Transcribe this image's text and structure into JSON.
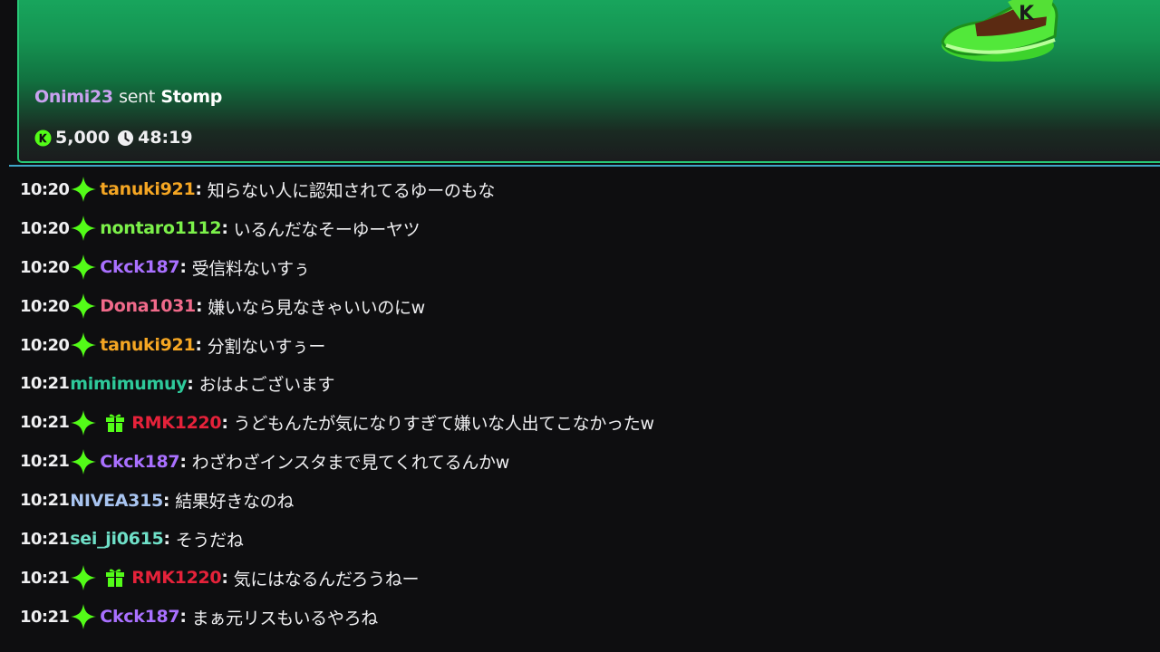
{
  "gift": {
    "user": "Onimi23",
    "verb": "sent",
    "item": "Stomp",
    "amount": "5,000",
    "time": "48:19",
    "icons": [
      "shoe-gift-art",
      "kick-coin-icon",
      "clock-icon"
    ]
  },
  "colors": {
    "accent_green": "#53fc18",
    "card_border": "#27c877",
    "divider": "#3fa6c9",
    "background": "#0e0e10"
  },
  "messages": [
    {
      "time": "10:20",
      "badge": "sparkle",
      "gift_badge": false,
      "user": "tanuki921",
      "color": "#f5a623",
      "text": "知らない人に認知されてるゆーのもな"
    },
    {
      "time": "10:20",
      "badge": "sparkle",
      "gift_badge": false,
      "user": "nontaro1112",
      "color": "#7cf14a",
      "text": "いるんだなそーゆーヤツ"
    },
    {
      "time": "10:20",
      "badge": "sparkle",
      "gift_badge": false,
      "user": "Ckck187",
      "color": "#a970ff",
      "text": "受信料ないすぅ"
    },
    {
      "time": "10:20",
      "badge": "sparkle",
      "gift_badge": false,
      "user": "Dona1031",
      "color": "#f06a8a",
      "text": "嫌いなら見なきゃいいのにw"
    },
    {
      "time": "10:20",
      "badge": "sparkle",
      "gift_badge": false,
      "user": "tanuki921",
      "color": "#f5a623",
      "text": "分割ないすぅー"
    },
    {
      "time": "10:21",
      "badge": "",
      "gift_badge": false,
      "user": "mimimumuy",
      "color": "#2ec99a",
      "text": "おはよございます"
    },
    {
      "time": "10:21",
      "badge": "sparkle",
      "gift_badge": true,
      "user": "RMK1220",
      "color": "#e5223a",
      "text": "うどもんたが気になりすぎて嫌いな人出てこなかったw"
    },
    {
      "time": "10:21",
      "badge": "sparkle",
      "gift_badge": false,
      "user": "Ckck187",
      "color": "#a970ff",
      "text": "わざわざインスタまで見てくれてるんかw"
    },
    {
      "time": "10:21",
      "badge": "",
      "gift_badge": false,
      "user": "NIVEA315",
      "color": "#a8c4f0",
      "text": "結果好きなのね"
    },
    {
      "time": "10:21",
      "badge": "",
      "gift_badge": false,
      "user": "sei_ji0615",
      "color": "#6fe0c8",
      "text": "そうだね"
    },
    {
      "time": "10:21",
      "badge": "sparkle",
      "gift_badge": true,
      "user": "RMK1220",
      "color": "#e5223a",
      "text": "気にはなるんだろうねー"
    },
    {
      "time": "10:21",
      "badge": "sparkle",
      "gift_badge": false,
      "user": "Ckck187",
      "color": "#a970ff",
      "text": "まぁ元リスもいるやろね"
    }
  ]
}
